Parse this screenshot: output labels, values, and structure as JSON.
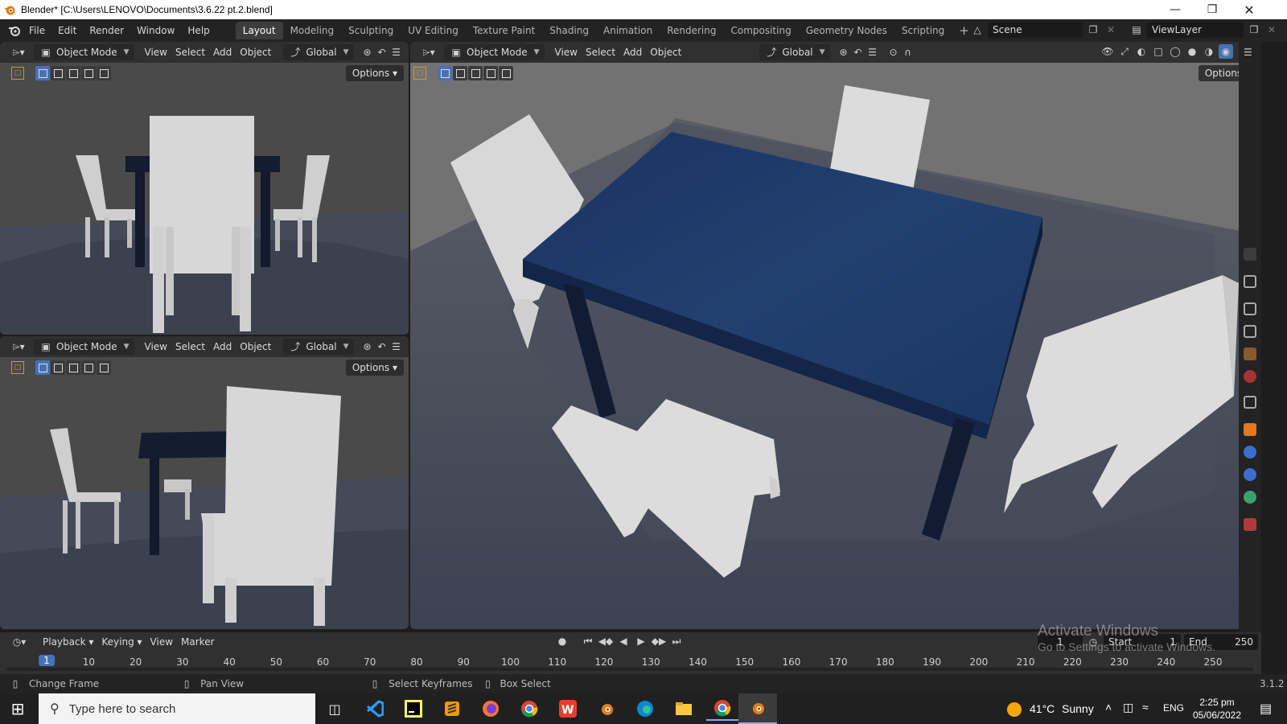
{
  "window": {
    "title": "Blender* [C:\\Users\\LENOVO\\Documents\\3.6.22 pt.2.blend]"
  },
  "menus": [
    "File",
    "Edit",
    "Render",
    "Window",
    "Help"
  ],
  "workspaces": [
    "Layout",
    "Modeling",
    "Sculpting",
    "UV Editing",
    "Texture Paint",
    "Shading",
    "Animation",
    "Rendering",
    "Compositing",
    "Geometry Nodes",
    "Scripting"
  ],
  "add_workspace": "+",
  "scene": {
    "name": "Scene"
  },
  "viewlayer": {
    "name": "ViewLayer"
  },
  "viewport_header": {
    "mode": "Object Mode",
    "view": "View",
    "select": "Select",
    "add": "Add",
    "object": "Object",
    "orientation": "Global",
    "options": "Options"
  },
  "timeline": {
    "playback": "Playback",
    "keying": "Keying",
    "view": "View",
    "marker": "Marker",
    "current_frame": "1",
    "frame_field": "1",
    "start_label": "Start",
    "start": "1",
    "end_label": "End",
    "end": "250",
    "ticks": [
      "1",
      "10",
      "20",
      "30",
      "40",
      "50",
      "60",
      "70",
      "80",
      "90",
      "100",
      "110",
      "120",
      "130",
      "140",
      "150",
      "160",
      "170",
      "180",
      "190",
      "200",
      "210",
      "220",
      "230",
      "240",
      "250"
    ]
  },
  "watermark": {
    "line1": "Activate Windows",
    "line2": "Go to Settings to activate Windows."
  },
  "statusbar": {
    "change_frame": "Change Frame",
    "pan_view": "Pan View",
    "select_keyframes": "Select Keyframes",
    "box_select": "Box Select",
    "version": "3.1.2"
  },
  "taskbar": {
    "search_placeholder": "Type here to search",
    "weather_temp": "41°C",
    "weather_text": "Sunny",
    "language": "ENG",
    "time": "2:25 pm",
    "date": "05/06/2022"
  },
  "colors": {
    "table_top": "#1d3563",
    "chair": "#d4d4d4",
    "floor": "#4a5060",
    "accent": "#4772b3"
  }
}
